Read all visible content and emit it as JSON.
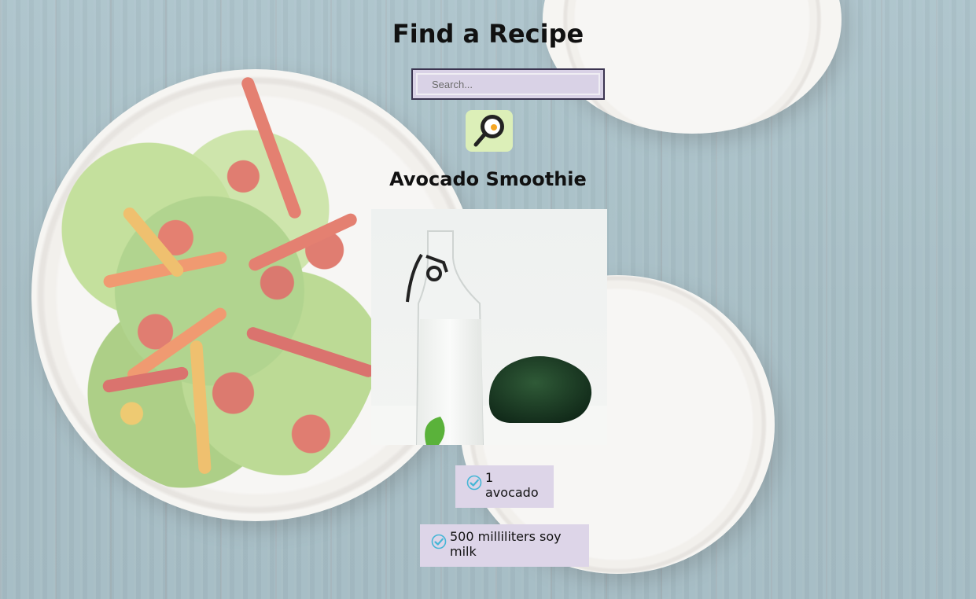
{
  "page": {
    "title": "Find a Recipe"
  },
  "search": {
    "placeholder": "Search...",
    "value": "",
    "button_icon": "frying-pan-egg-icon"
  },
  "recipe": {
    "title": "Avocado Smoothie",
    "image_alt": "Avocado Smoothie"
  },
  "ingredients": [
    {
      "icon": "check-circle-icon",
      "label": "1 avocado"
    },
    {
      "icon": "check-circle-icon",
      "label": "500 milliliters soy milk"
    }
  ],
  "colors": {
    "search_button_bg": "#dcefb8",
    "search_field_bg": "#d9d2e6",
    "ingredient_bg": "#ddd5e8",
    "check_icon": "#45b6d6"
  }
}
